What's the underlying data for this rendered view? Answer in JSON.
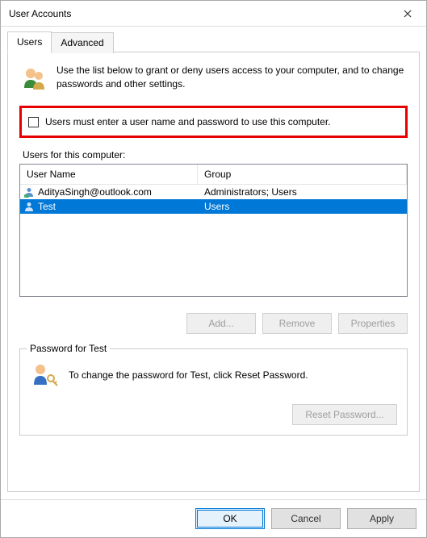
{
  "window": {
    "title": "User Accounts"
  },
  "tabs": {
    "users": "Users",
    "advanced": "Advanced"
  },
  "intro": "Use the list below to grant or deny users access to your computer, and to change passwords and other settings.",
  "check": {
    "label": "Users must enter a user name and password to use this computer."
  },
  "list_label": "Users for this computer:",
  "columns": {
    "name": "User Name",
    "group": "Group"
  },
  "users": [
    {
      "name": "AdityaSingh@outlook.com",
      "group": "Administrators; Users",
      "selected": false
    },
    {
      "name": "Test",
      "group": "Users",
      "selected": true
    }
  ],
  "buttons": {
    "add": "Add...",
    "remove": "Remove",
    "properties": "Properties",
    "reset": "Reset Password...",
    "ok": "OK",
    "cancel": "Cancel",
    "apply": "Apply"
  },
  "password_group": {
    "legend": "Password for Test",
    "text": "To change the password for Test, click Reset Password."
  }
}
